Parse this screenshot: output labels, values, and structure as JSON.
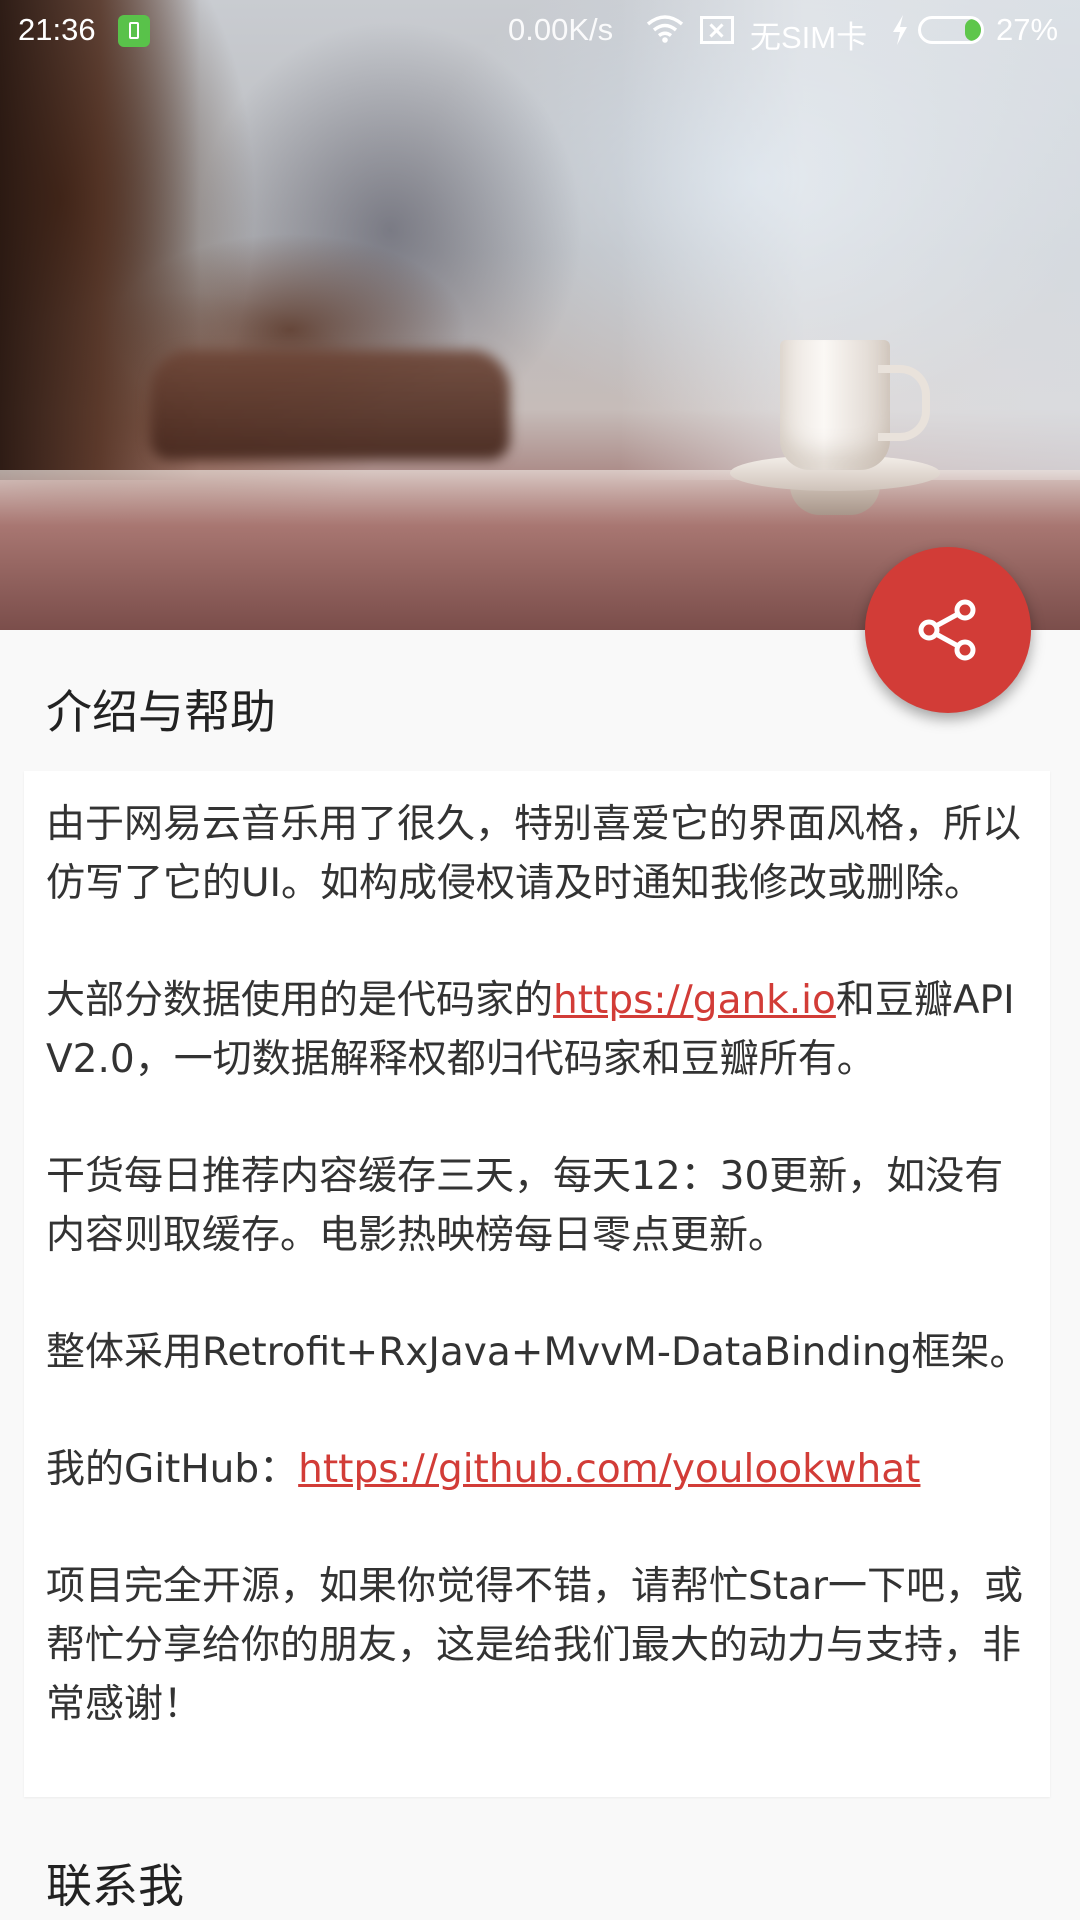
{
  "status_bar": {
    "time": "21:36",
    "network_speed": "0.00K/s",
    "sim_status": "无SIM卡",
    "battery_percent": "27%",
    "battery_level": 0.27,
    "icons": [
      "app-notification-icon",
      "wifi-icon",
      "no-sim-icon",
      "charging-icon",
      "battery-icon"
    ]
  },
  "header": {
    "image_alt": "header-photo-coffee-cup"
  },
  "fab": {
    "icon": "share-icon",
    "color": "#d23c37"
  },
  "intro": {
    "title": "介绍与帮助",
    "p1": "由于网易云音乐用了很久，特别喜爱它的界面风格，所以仿写了它的UI。如构成侵权请及时通知我修改或删除。",
    "p2_before": " 大部分数据使用的是代码家的",
    "p2_link": "https://gank.io",
    "p2_after": "和豆瓣APIV2.0，一切数据解释权都归代码家和豆瓣所有。",
    "p3": " 干货每日推荐内容缓存三天，每天12：30更新，如没有内容则取缓存。电影热映榜每日零点更新。",
    "p4": " 整体采用Retrofit+RxJava+MvvM-DataBinding框架。",
    "p5_before": " 我的GitHub：",
    "p5_link": "https://github.com/youlookwhat",
    "p6": " 项目完全开源，如果你觉得不错，请帮忙Star一下吧，或帮忙分享给你的朋友，这是给我们最大的动力与支持，非常感谢！"
  },
  "contact": {
    "title": "联系我"
  },
  "colors": {
    "accent": "#d23c37",
    "background": "#f9f9f9",
    "card": "#ffffff",
    "text": "#333333"
  }
}
